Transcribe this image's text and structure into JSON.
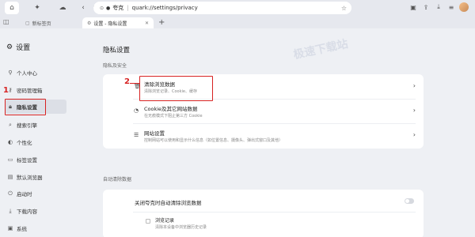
{
  "toolbar": {
    "address_site_label": "夸克",
    "address_url": "quark://settings/privacy"
  },
  "tabs": [
    {
      "label": "新标签页"
    },
    {
      "label": "设置 - 隐私设置"
    }
  ],
  "sidebar": {
    "title": "设置",
    "items": [
      {
        "label": "个人中心",
        "icon": "person-icon"
      },
      {
        "label": "密码管理箱",
        "icon": "key-icon"
      },
      {
        "label": "隐私设置",
        "icon": "lock-icon",
        "active": true
      },
      {
        "label": "搜索引擎",
        "icon": "search-icon"
      },
      {
        "label": "个性化",
        "icon": "palette-icon"
      },
      {
        "label": "标签设置",
        "icon": "tab-icon"
      },
      {
        "label": "默认浏览器",
        "icon": "browser-icon"
      },
      {
        "label": "启动时",
        "icon": "power-icon"
      },
      {
        "label": "下载内容",
        "icon": "download-icon"
      },
      {
        "label": "系统",
        "icon": "system-icon"
      }
    ]
  },
  "main": {
    "title": "隐私设置",
    "privacy_section": {
      "label": "隐私及安全",
      "rows": [
        {
          "title": "清除浏览数据",
          "subtitle": "清除浏览记录、Cookie、缓存"
        },
        {
          "title": "Cookie及其它网站数据",
          "subtitle": "在无痕模式下阻止第三方 Cookie"
        },
        {
          "title": "网站设置",
          "subtitle": "控制网站可以使用和显示什么信息（如位置信息、摄像头、弹出式窗口及其他）"
        }
      ]
    },
    "auto_clear_section": {
      "label": "自动清除数据",
      "toggle_title": "关闭夸克时自动清除浏览数据",
      "toggle_on": false,
      "option_title": "浏览记录",
      "option_subtitle": "清除本设备中浏览器历史记录"
    }
  },
  "watermark": "极速下载站",
  "annotations": {
    "step1": "1",
    "step2": "2",
    "color": "#d72222"
  }
}
